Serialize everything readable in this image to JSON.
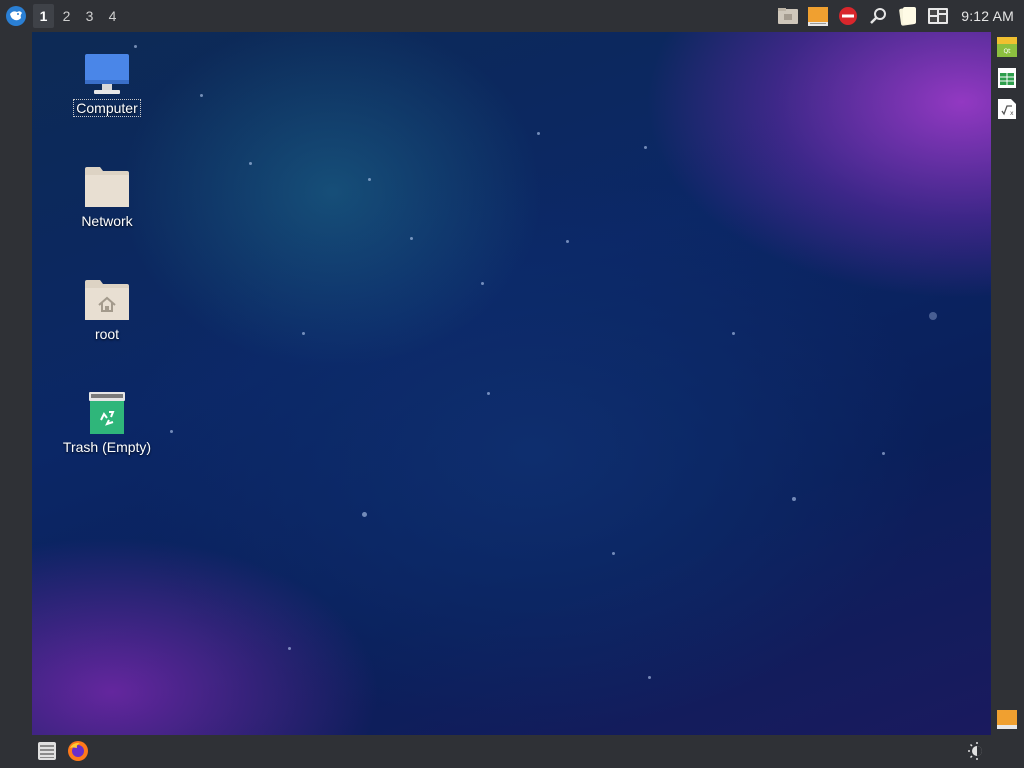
{
  "top_panel": {
    "menu_icon": "xfce-mouse-menu-icon",
    "workspaces": [
      "1",
      "2",
      "3",
      "4"
    ],
    "active_workspace": "1",
    "tray_icons": [
      "file-manager-icon",
      "storage-drive-icon",
      "no-entry-icon",
      "search-icon",
      "notes-icon",
      "screenshot-icon"
    ],
    "clock": "9:12 AM"
  },
  "desktop": {
    "items": [
      {
        "label": "Computer",
        "icon": "computer-icon",
        "selected": true
      },
      {
        "label": "Network",
        "icon": "folder-icon"
      },
      {
        "label": "root",
        "icon": "home-folder-icon"
      },
      {
        "label": "Trash (Empty)",
        "icon": "trash-icon"
      }
    ]
  },
  "right_panel": {
    "icons": [
      "qt-app-icon",
      "spreadsheet-icon",
      "formula-icon",
      "drive-icon"
    ]
  },
  "bottom_panel": {
    "icons": [
      "terminal-icon",
      "firefox-icon",
      "brightness-icon"
    ]
  },
  "colors": {
    "panel": "#2f3136",
    "accent_orange": "#f0a030",
    "no_entry_red": "#d9262c",
    "computer_blue": "#4a86e8",
    "trash_green": "#2fb67a"
  }
}
